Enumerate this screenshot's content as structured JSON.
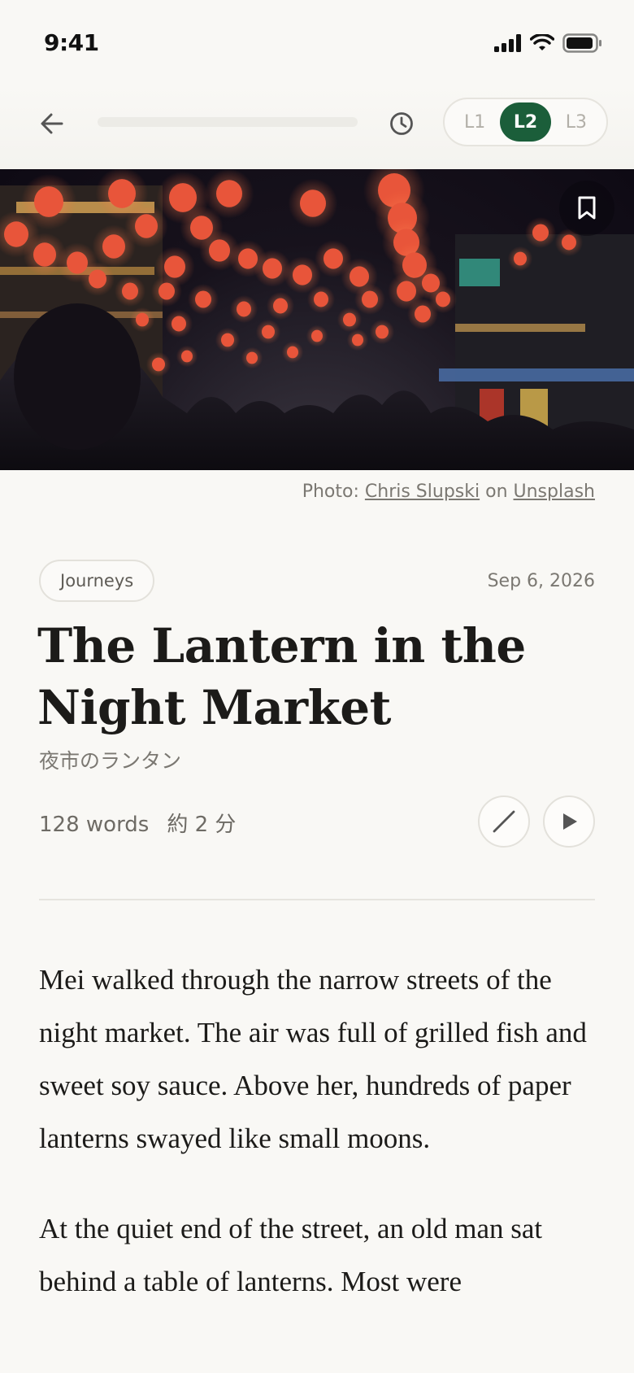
{
  "status_bar": {
    "time": "9:41"
  },
  "toolbar": {
    "progress": 0,
    "levels": [
      {
        "label": "L1",
        "active": false
      },
      {
        "label": "L2",
        "active": true
      },
      {
        "label": "L3",
        "active": false
      }
    ]
  },
  "hero": {
    "credit_prefix": "Photo:",
    "photographer": "Chris Slupski",
    "credit_mid": "on",
    "source": "Unsplash"
  },
  "article": {
    "category": "Journeys",
    "date": "Sep 6, 2026",
    "title": "The Lantern in the Night Market",
    "subtitle": "夜市のランタン",
    "word_count": "128 words",
    "read_time": "約 2 分",
    "paragraphs": [
      "Mei walked through the narrow streets of the night market. The air was full of grilled fish and sweet soy sauce. Above her, hundreds of paper lanterns swayed like small moons.",
      "At the quiet end of the street, an old man sat behind a table of lanterns. Most were"
    ]
  },
  "colors": {
    "accent": "#1b5e3a",
    "background": "#f9f8f5",
    "text": "#1c1b19",
    "muted": "#7b7872"
  },
  "icons": [
    "wifi-icon",
    "signal-icon",
    "battery-icon",
    "back-arrow-icon",
    "clock-icon",
    "bookmark-icon",
    "pencil-icon",
    "play-icon"
  ]
}
